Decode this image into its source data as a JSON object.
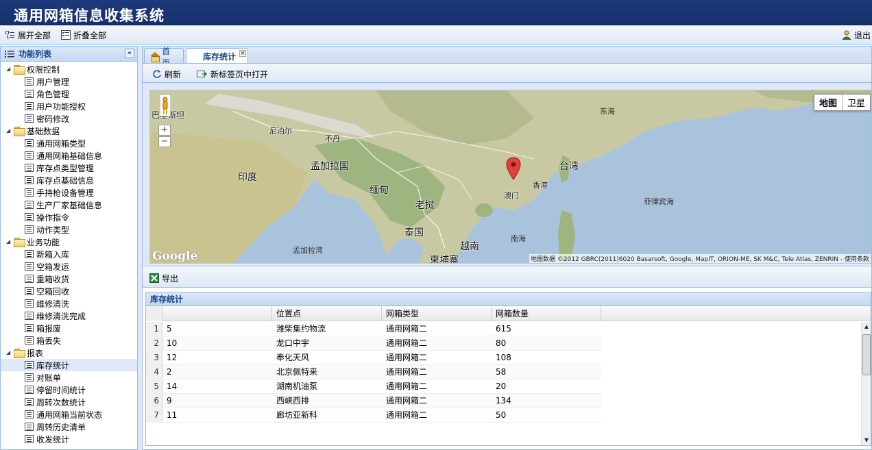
{
  "app": {
    "title": "通用网箱信息收集系统"
  },
  "toolbar": {
    "expand_all": "展开全部",
    "collapse_all": "折叠全部",
    "logout": "退出"
  },
  "sidebar": {
    "title": "功能列表",
    "groups": [
      {
        "label": "权限控制",
        "items": [
          "用户管理",
          "角色管理",
          "用户功能授权",
          "密码修改"
        ]
      },
      {
        "label": "基础数据",
        "items": [
          "通用网箱类型",
          "通用网箱基础信息",
          "库存点类型管理",
          "库存点基础信息",
          "手持枪设备管理",
          "生产厂家基础信息",
          "操作指令",
          "动作类型"
        ]
      },
      {
        "label": "业务功能",
        "items": [
          "新箱入库",
          "空箱发运",
          "重箱收货",
          "空箱回收",
          "维修清洗",
          "维修清洗完成",
          "箱报废",
          "箱丢失"
        ]
      },
      {
        "label": "报表",
        "items": [
          "库存统计",
          "对账单",
          "停留时间统计",
          "周转次数统计",
          "通用网箱当前状态",
          "周转历史清单",
          "收发统计"
        ]
      }
    ],
    "selected": "库存统计"
  },
  "tabs": [
    {
      "label": "首页"
    },
    {
      "label": "库存统计"
    }
  ],
  "subtoolbar": {
    "refresh": "刷新",
    "open_new_tab": "新标签页中打开"
  },
  "map": {
    "type_map": "地图",
    "type_satellite": "卫星",
    "zoom_in": "+",
    "zoom_out": "−",
    "logo": "Google",
    "copyright": "地图数据 ©2012 GBRC(2011)6020 Basarsoft, Google, MapIT, ORION-ME, SK M&C, Tele Atlas, ZENRIN - 使用条款",
    "labels": {
      "pakistan": "巴基斯坦",
      "nepal": "尼泊尔",
      "bhutan": "不丹",
      "bangladesh": "孟加拉国",
      "india": "印度",
      "myanmar": "缅甸",
      "laos": "老挝",
      "thailand": "泰国",
      "vietnam": "越南",
      "cambodia": "柬埔寨",
      "bay_of_bengal": "孟加拉湾",
      "south_china_sea": "南海",
      "east_china_sea": "东海",
      "taiwan": "台湾",
      "philippine_sea": "菲律宾海",
      "hong_kong": "香港",
      "macau": "澳门"
    }
  },
  "export": {
    "label": "导出"
  },
  "grid": {
    "title": "库存统计",
    "columns": [
      "",
      "位置点",
      "网箱类型",
      "网箱数量"
    ],
    "rows": [
      {
        "n": "1",
        "id": "5",
        "location": "潍柴集约物流",
        "type": "通用网箱二",
        "count": "615"
      },
      {
        "n": "2",
        "id": "10",
        "location": "龙口中宇",
        "type": "通用网箱二",
        "count": "80"
      },
      {
        "n": "3",
        "id": "12",
        "location": "奉化天风",
        "type": "通用网箱二",
        "count": "108"
      },
      {
        "n": "4",
        "id": "2",
        "location": "北京佩特来",
        "type": "通用网箱二",
        "count": "58"
      },
      {
        "n": "5",
        "id": "14",
        "location": "湖南机油泵",
        "type": "通用网箱二",
        "count": "20"
      },
      {
        "n": "6",
        "id": "9",
        "location": "西峡西排",
        "type": "通用网箱二",
        "count": "134"
      },
      {
        "n": "7",
        "id": "11",
        "location": "廊坊亚新科",
        "type": "通用网箱二",
        "count": "50"
      }
    ]
  },
  "colors": {
    "header_bg": "#1e3a7a",
    "panel_border": "#99bbe8",
    "panel_title": "#15428b",
    "selected_bg": "#dfe8f6"
  }
}
